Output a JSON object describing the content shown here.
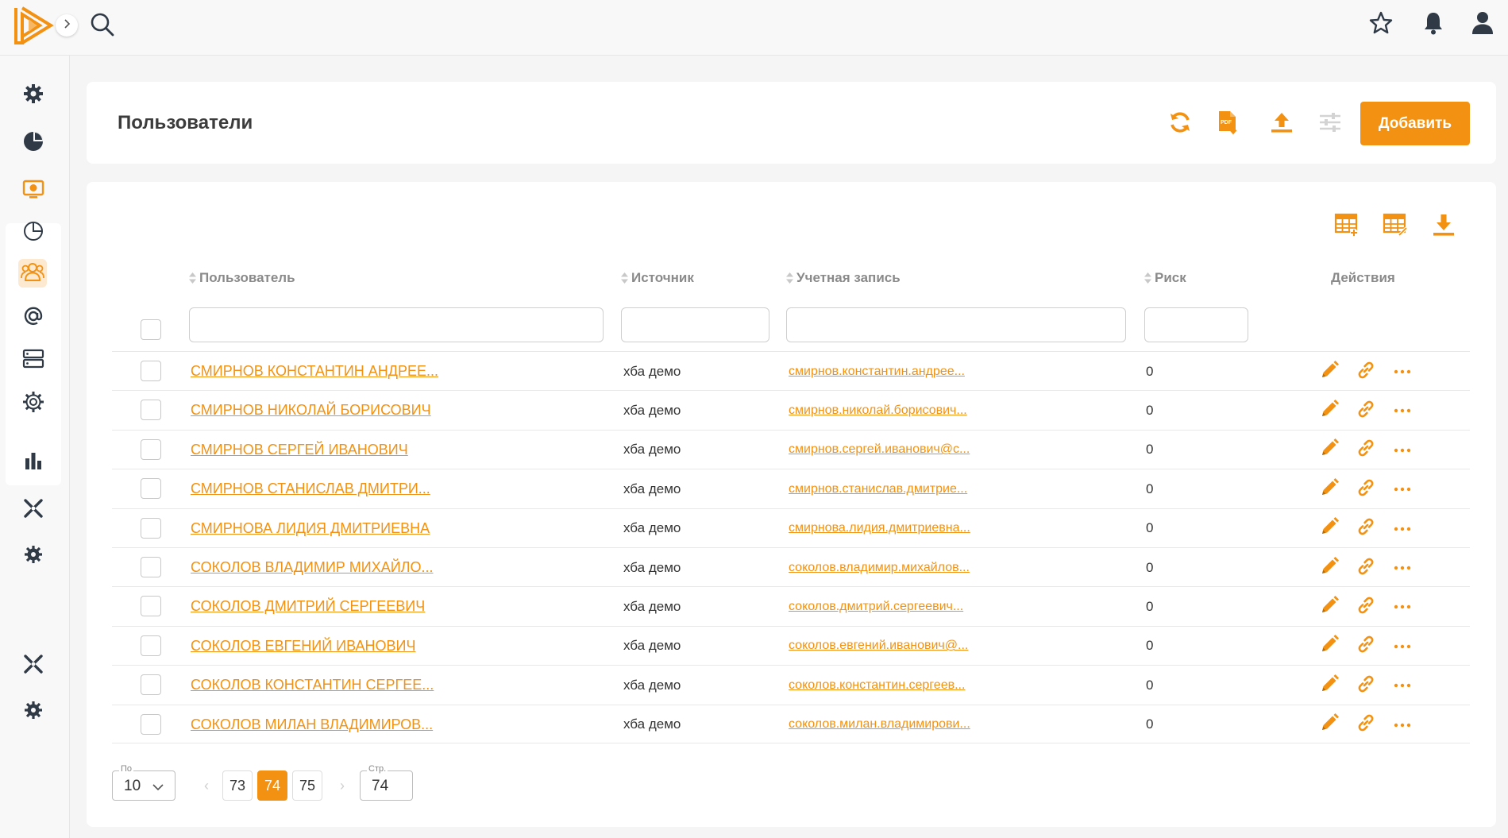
{
  "page": {
    "title": "Пользователи"
  },
  "header": {
    "add_label": "Добавить"
  },
  "columns": {
    "user": "Пользователь",
    "source": "Источник",
    "account": "Учетная запись",
    "risk": "Риск",
    "actions": "Действия"
  },
  "rows": [
    {
      "user": "СМИРНОВ КОНСТАНТИН АНДРЕЕ...",
      "source": "хба демо",
      "account": "смирнов.константин.андрее...",
      "risk": "0"
    },
    {
      "user": "СМИРНОВ НИКОЛАЙ БОРИСОВИЧ",
      "source": "хба демо",
      "account": "смирнов.николай.борисович...",
      "risk": "0"
    },
    {
      "user": "СМИРНОВ СЕРГЕЙ ИВАНОВИЧ",
      "source": "хба демо",
      "account": "смирнов.сергей.иванович@с...",
      "risk": "0"
    },
    {
      "user": "СМИРНОВ СТАНИСЛАВ ДМИТРИ...",
      "source": "хба демо",
      "account": "смирнов.станислав.дмитрие...",
      "risk": "0"
    },
    {
      "user": "СМИРНОВА ЛИДИЯ ДМИТРИЕВНА",
      "source": "хба демо",
      "account": "смирнова.лидия.дмитриевна...",
      "risk": "0"
    },
    {
      "user": "СОКОЛОВ ВЛАДИМИР МИХАЙЛО...",
      "source": "хба демо",
      "account": "соколов.владимир.михайлов...",
      "risk": "0"
    },
    {
      "user": "СОКОЛОВ ДМИТРИЙ СЕРГЕЕВИЧ",
      "source": "хба демо",
      "account": "соколов.дмитрий.сергеевич...",
      "risk": "0"
    },
    {
      "user": "СОКОЛОВ ЕВГЕНИЙ ИВАНОВИЧ",
      "source": "хба демо",
      "account": "соколов.евгений.иванович@...",
      "risk": "0"
    },
    {
      "user": "СОКОЛОВ КОНСТАНТИН СЕРГЕЕ...",
      "source": "хба демо",
      "account": "соколов.константин.сергеев...",
      "risk": "0"
    },
    {
      "user": "СОКОЛОВ МИЛАН ВЛАДИМИРОВ...",
      "source": "хба демо",
      "account": "соколов.милан.владимирови...",
      "risk": "0"
    }
  ],
  "pager": {
    "per_page_legend": "По",
    "per_page_value": "10",
    "pages": [
      "73",
      "74",
      "75"
    ],
    "current_page": "74",
    "page_field_legend": "Стр.",
    "page_field_value": "74"
  },
  "colors": {
    "accent": "#f39212",
    "sidebar_active_bg": "#fde9cf",
    "icon_dark": "#2f3a46"
  },
  "icons": {
    "topbar": [
      "logo",
      "chevron-right-icon",
      "search-icon",
      "star-icon",
      "bell-icon",
      "user-icon"
    ],
    "sidebar": [
      "gear-icon",
      "pie-chart-icon",
      "monitor-icon",
      "pie-outline-icon",
      "users-icon",
      "at-icon",
      "server-icon",
      "settings-outline-icon",
      "bar-chart-icon",
      "cross-tools-icon",
      "gear-cluster-icon",
      "cross-tools-icon",
      "gear-cluster-icon"
    ],
    "header": [
      "refresh-icon",
      "pdf-download-icon",
      "upload-icon",
      "sliders-icon"
    ],
    "table_tools": [
      "table-add-icon",
      "table-edit-icon",
      "download-icon"
    ],
    "row_actions": [
      "edit-icon",
      "link-icon",
      "more-icon"
    ]
  }
}
